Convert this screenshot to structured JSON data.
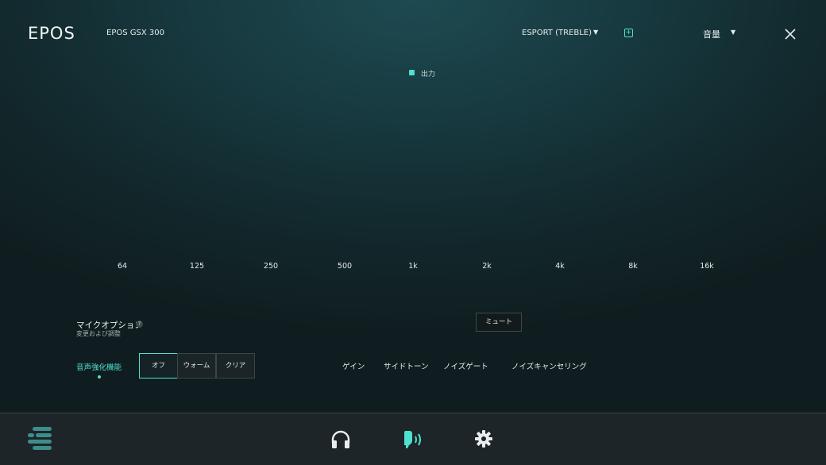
{
  "header": {
    "logo": "EPOS",
    "device": "EPOS GSX 300",
    "preset": "ESPORT (TREBLE)",
    "preset_caret": "▼",
    "add_icon": "+",
    "mode": "音量",
    "mode_caret": "▼"
  },
  "legend": {
    "label": "出力"
  },
  "eq": {
    "frequencies": [
      "64",
      "125",
      "250",
      "500",
      "1k",
      "2k",
      "4k",
      "8k",
      "16k"
    ]
  },
  "mic": {
    "title": "マイクオプション",
    "help": "?",
    "subtitle": "変更および調整",
    "mute": "ミュート",
    "enhancement_label": "音声強化機能",
    "enhancement_options": [
      "オフ",
      "ウォーム",
      "クリア"
    ],
    "enhancement_selected": "オフ",
    "tabs": [
      "ゲイン",
      "サイドトーン",
      "ノイズゲート",
      "ノイズキャンセリング"
    ]
  },
  "nav": {
    "icons": [
      "menu-icon",
      "headphones-icon",
      "microphone-icon",
      "settings-gear-icon"
    ],
    "active": "microphone-icon"
  },
  "colors": {
    "accent": "#4fe0cf",
    "navbar": "#1d2528"
  }
}
